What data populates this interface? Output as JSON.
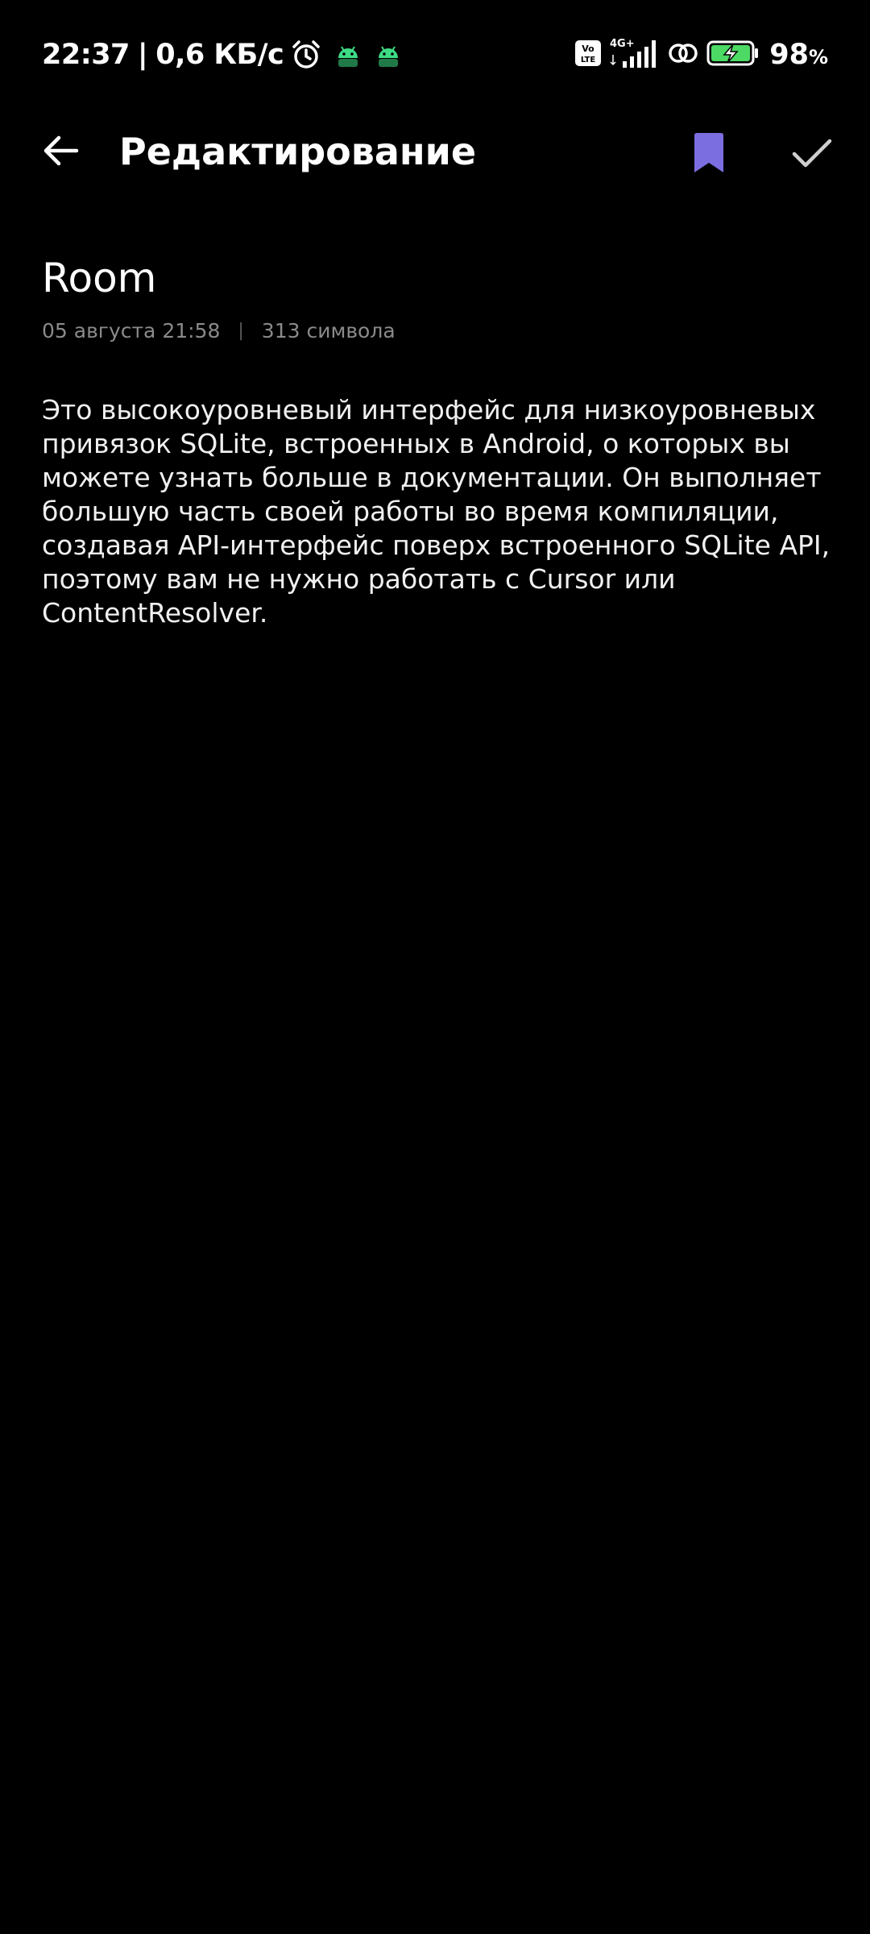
{
  "status_bar": {
    "time": "22:37",
    "separator": "|",
    "speed": "0,6 КБ/с",
    "icons_left": [
      "alarm-icon",
      "android-icon",
      "android-icon"
    ],
    "volte_label": "Vo LTE",
    "network_label": "4G+",
    "icons_right": [
      "volte-icon",
      "signal-icon",
      "link-icon",
      "battery-charging-icon"
    ],
    "battery_value": "98",
    "battery_unit": "%",
    "colors": {
      "android": "#3ddc84",
      "battery_fill": "#4cd964"
    }
  },
  "app_bar": {
    "title": "Редактирование",
    "back_icon": "arrow-left-icon",
    "bookmark_icon": "bookmark-icon",
    "confirm_icon": "check-icon",
    "accent_color": "#7b6ee0"
  },
  "note": {
    "title": "Room",
    "date": "05 августа 21:58",
    "divider": "|",
    "char_count": "313 символа",
    "body": "Это высокоуровневый интерфейс для низкоуровневых привязок SQLite, встроенных в Android, о которых вы можете узнать больше в документации. Он выполняет большую часть своей работы во время компиляции, создавая API-интерфейс поверх встроенного SQLite API, поэтому вам не нужно работать с Cursor или ContentResolver."
  }
}
